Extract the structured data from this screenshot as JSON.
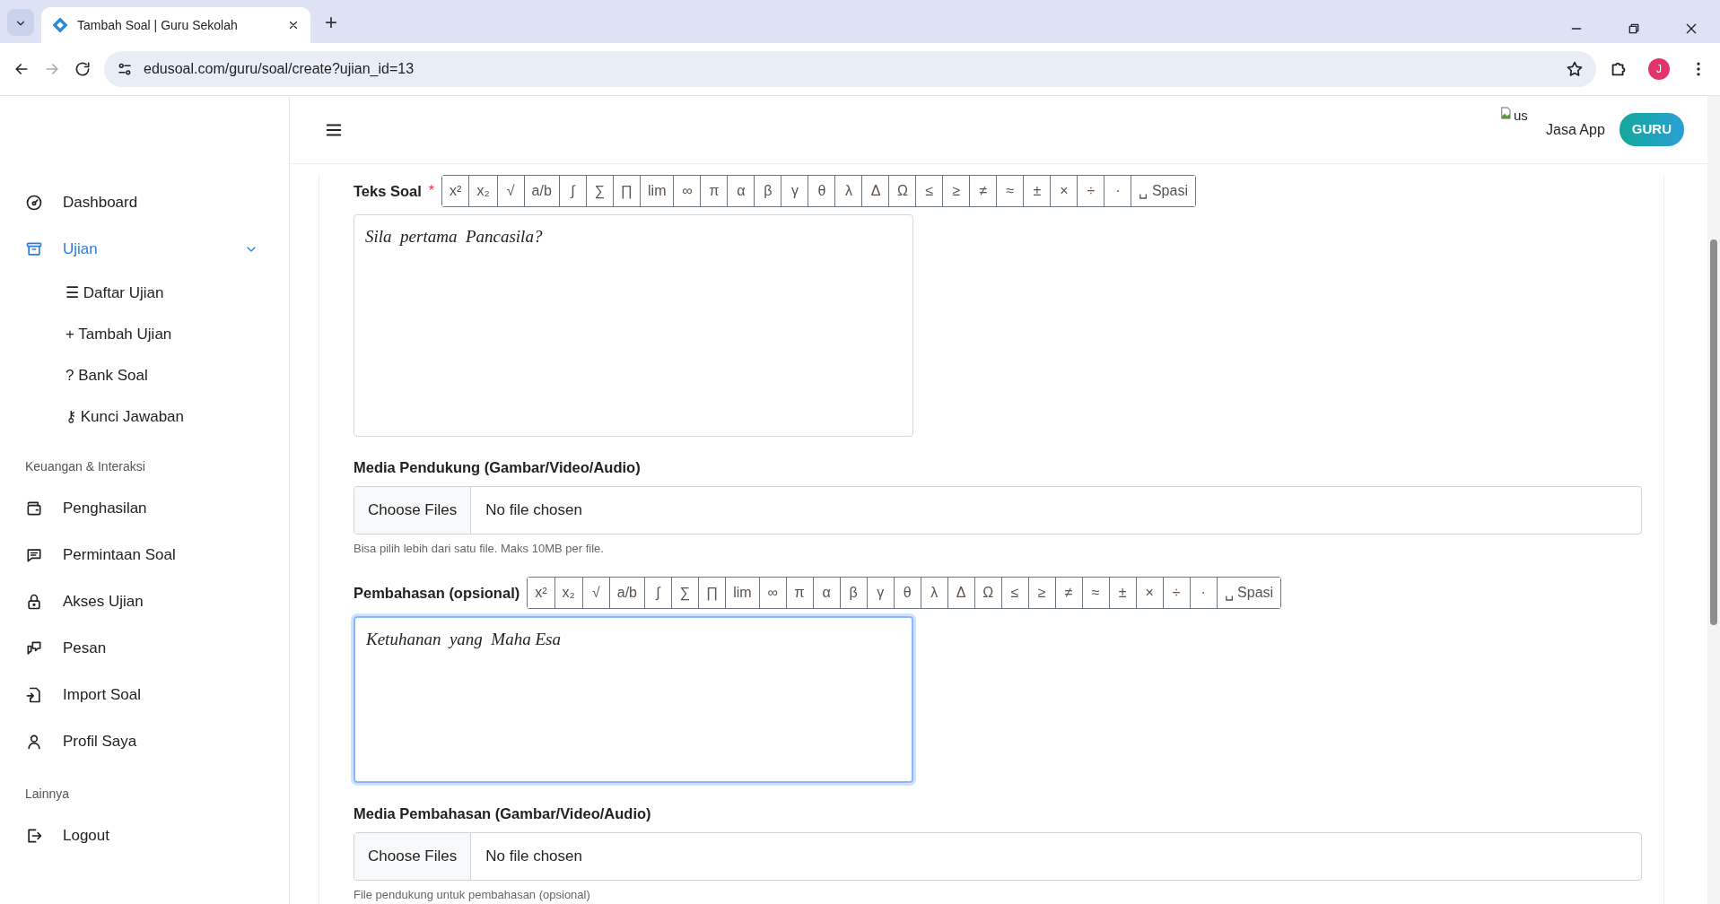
{
  "browser": {
    "tabs": [
      {
        "title": "Tambah Soal | Guru Sekolah",
        "selected": true
      }
    ],
    "new_tab": "+",
    "url": "edusoal.com/guru/soal/create?ujian_id=13",
    "profile_initial": "J"
  },
  "header": {
    "avatar_alt": "us",
    "user_name": "Jasa App",
    "role_badge": "GURU"
  },
  "sidebar": {
    "sections": [
      {
        "items": [
          {
            "label": "Dashboard",
            "selected": false
          },
          {
            "label": "Ujian",
            "selected": true,
            "expanded": true,
            "children": [
              {
                "glyph": "☰",
                "label": "Daftar Ujian"
              },
              {
                "glyph": "+",
                "label": "Tambah Ujian"
              },
              {
                "glyph": "?",
                "label": "Bank Soal"
              },
              {
                "glyph": "⚷",
                "label": "Kunci Jawaban"
              }
            ]
          }
        ]
      },
      {
        "title": "Keuangan & Interaksi",
        "items": [
          {
            "label": "Penghasilan",
            "selected": false
          },
          {
            "label": "Permintaan Soal",
            "selected": false
          },
          {
            "label": "Akses Ujian",
            "selected": false
          },
          {
            "label": "Pesan",
            "selected": false
          },
          {
            "label": "Import Soal",
            "selected": false
          },
          {
            "label": "Profil Saya",
            "selected": false
          }
        ]
      },
      {
        "title": "Lainnya",
        "items": [
          {
            "label": "Logout",
            "selected": false
          }
        ]
      }
    ]
  },
  "form": {
    "fields": [
      {
        "kind": "editor",
        "label": "Teks Soal",
        "required_mark": "*",
        "toolbar": [
          "x²",
          "x₂",
          "√",
          "a/b",
          "∫",
          "∑",
          "∏",
          "lim",
          "∞",
          "π",
          "α",
          "β",
          "γ",
          "θ",
          "λ",
          "Δ",
          "Ω",
          "≤",
          "≥",
          "≠",
          "≈",
          "±",
          "×",
          "÷",
          "·",
          "␣ Spasi"
        ],
        "value": "Sila  pertama  Pancasila?",
        "focused": false
      },
      {
        "kind": "file",
        "label": "Media Pendukung (Gambar/Video/Audio)",
        "button": "Choose Files",
        "status": "No file chosen",
        "hint": "Bisa pilih lebih dari satu file. Maks 10MB per file."
      },
      {
        "kind": "editor",
        "label": "Pembahasan (opsional)",
        "toolbar": [
          "x²",
          "x₂",
          "√",
          "a/b",
          "∫",
          "∑",
          "∏",
          "lim",
          "∞",
          "π",
          "α",
          "β",
          "γ",
          "θ",
          "λ",
          "Δ",
          "Ω",
          "≤",
          "≥",
          "≠",
          "≈",
          "±",
          "×",
          "÷",
          "·",
          "␣ Spasi"
        ],
        "value": "Ketuhanan  yang  Maha Esa",
        "focused": true
      },
      {
        "kind": "file",
        "label": "Media Pembahasan (Gambar/Video/Audio)",
        "button": "Choose Files",
        "status": "No file chosen",
        "hint": "File pendukung untuk pembahasan (opsional)"
      }
    ]
  }
}
